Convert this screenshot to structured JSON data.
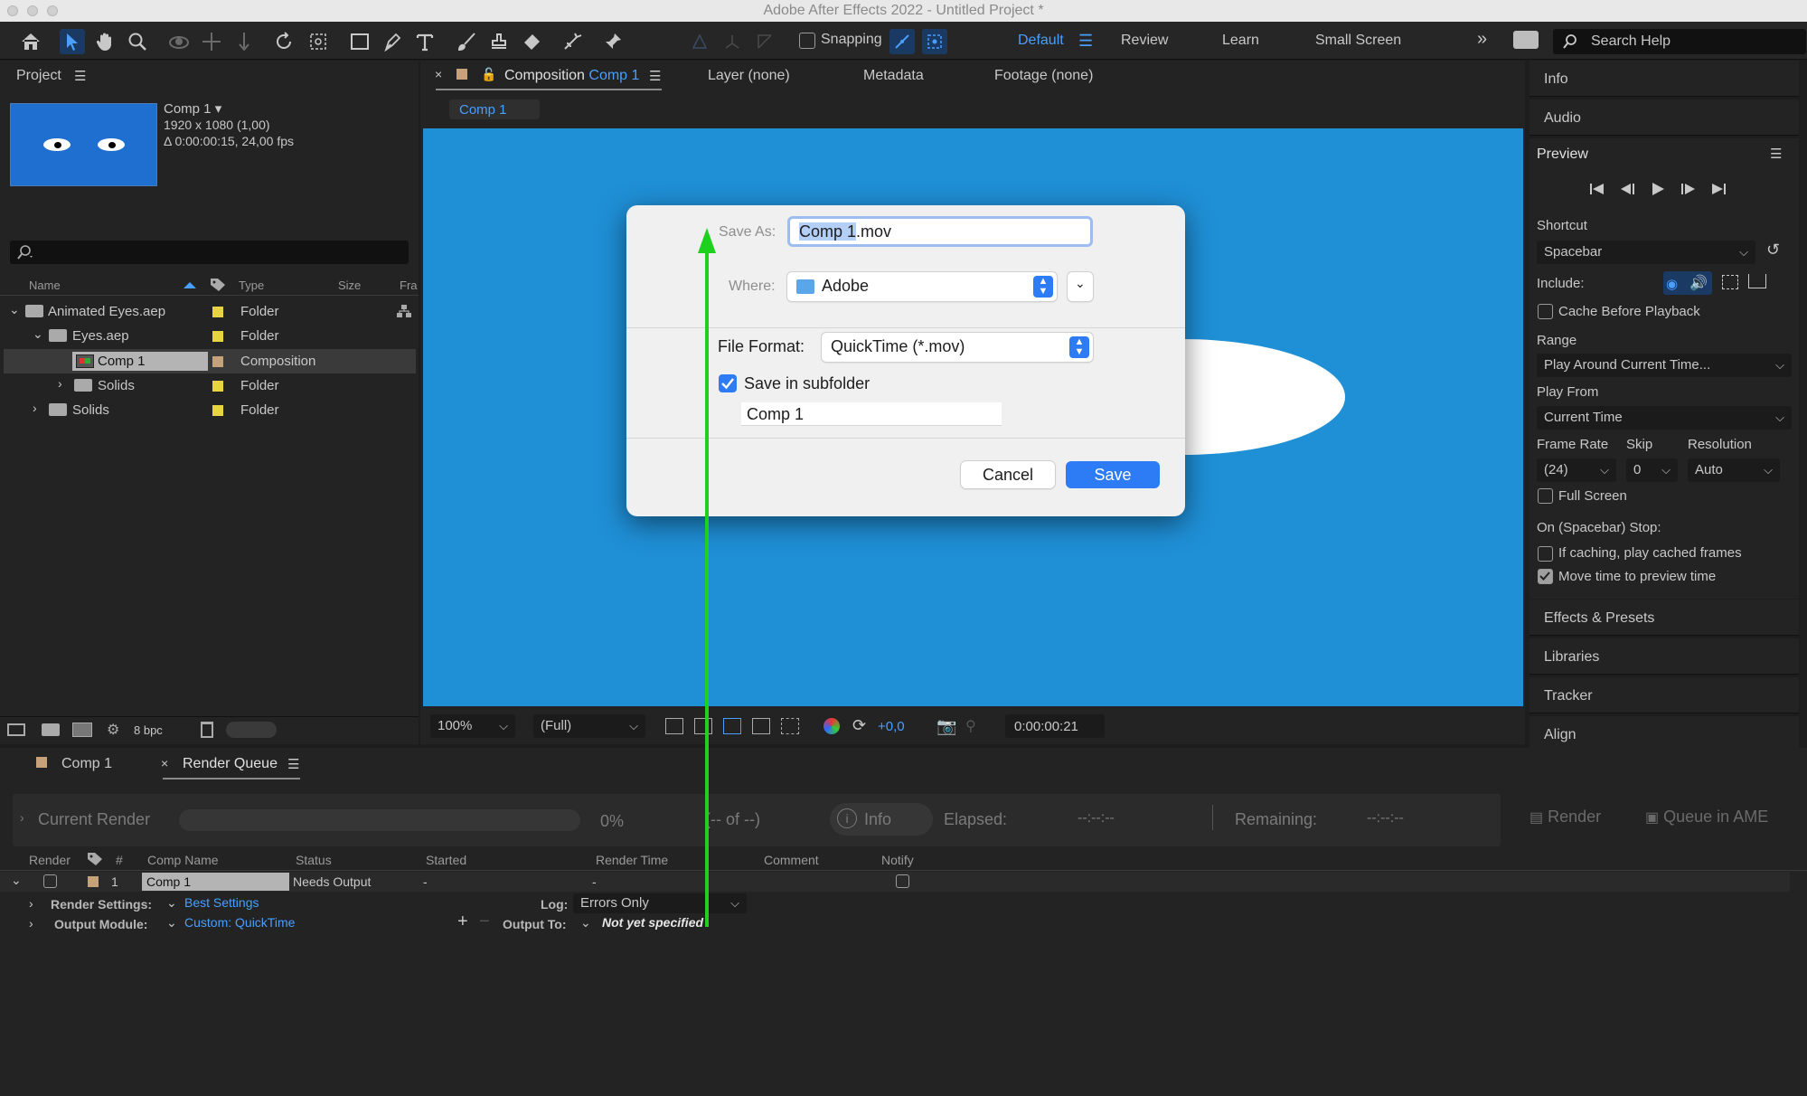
{
  "app": {
    "title": "Adobe After Effects 2022 - Untitled Project *"
  },
  "toolbar": {
    "snapping_label": "Snapping",
    "workspaces": [
      "Default",
      "Review",
      "Learn",
      "Small Screen"
    ],
    "search_placeholder": "Search Help"
  },
  "project": {
    "tab_label": "Project",
    "comp_name": "Comp 1",
    "comp_size": "1920 x 1080 (1,00)",
    "comp_duration": "Δ 0:00:00:15, 24,00 fps",
    "columns": [
      "Name",
      "Type",
      "Size",
      "Fra"
    ],
    "items": [
      {
        "name": "Animated Eyes.aep",
        "type": "Folder"
      },
      {
        "name": "Eyes.aep",
        "type": "Folder"
      },
      {
        "name": "Comp 1",
        "type": "Composition"
      },
      {
        "name": "Solids",
        "type": "Folder"
      },
      {
        "name": "Solids",
        "type": "Folder"
      }
    ],
    "bpc": "8 bpc"
  },
  "viewer": {
    "tabs": {
      "composition_prefix": "Composition",
      "composition_name": "Comp 1",
      "layer": "Layer (none)",
      "metadata": "Metadata",
      "footage": "Footage (none)"
    },
    "breadcrumb": "Comp 1",
    "zoom": "100%",
    "resolution": "(Full)",
    "exposure": "+0,0",
    "timecode": "0:00:00:21",
    "bg_color": "#1f8fd6"
  },
  "dialog": {
    "save_as_label": "Save As:",
    "save_as_selected": "Comp 1",
    "save_as_rest": ".mov",
    "where_label": "Where:",
    "where_value": "Adobe",
    "file_format_label": "File Format:",
    "file_format_value": "QuickTime (*.mov)",
    "subfolder_label": "Save in subfolder",
    "subfolder_checked": true,
    "subfolder_name": "Comp 1",
    "cancel_label": "Cancel",
    "save_label": "Save"
  },
  "right_panel": {
    "info": "Info",
    "audio": "Audio",
    "preview": "Preview",
    "shortcut_label": "Shortcut",
    "shortcut_value": "Spacebar",
    "include_label": "Include:",
    "cache_before_playback": "Cache Before Playback",
    "range_label": "Range",
    "range_value": "Play Around Current Time...",
    "play_from_label": "Play From",
    "play_from_value": "Current Time",
    "frame_rate_label": "Frame Rate",
    "skip_label": "Skip",
    "resolution_label": "Resolution",
    "frame_rate_value": "(24)",
    "skip_value": "0",
    "resolution_value": "Auto",
    "full_screen": "Full Screen",
    "on_stop_label": "On (Spacebar) Stop:",
    "if_caching": "If caching, play cached frames",
    "move_time": "Move time to preview time",
    "move_time_checked": true,
    "effects_presets": "Effects & Presets",
    "libraries": "Libraries",
    "tracker": "Tracker",
    "align": "Align"
  },
  "render_queue": {
    "tabs": [
      "Comp 1",
      "Render Queue"
    ],
    "current_render": "Current Render",
    "progress_pct": "0%",
    "of_text": "(-- of --)",
    "info_btn": "Info",
    "elapsed_label": "Elapsed:",
    "elapsed_value": "--:--:--",
    "remaining_label": "Remaining:",
    "remaining_value": "--:--:--",
    "render_btn": "Render",
    "queue_ame_btn": "Queue in AME",
    "columns": [
      "Render",
      "#",
      "Comp Name",
      "Status",
      "Started",
      "Render Time",
      "Comment",
      "Notify"
    ],
    "item": {
      "number": "1",
      "comp_name": "Comp 1",
      "status": "Needs Output",
      "started": "-",
      "render_time": "-"
    },
    "render_settings_label": "Render Settings:",
    "render_settings_value": "Best Settings",
    "log_label": "Log:",
    "log_value": "Errors Only",
    "output_module_label": "Output Module:",
    "output_module_value": "Custom: QuickTime",
    "output_to_label": "Output To:",
    "output_to_value": "Not yet specified"
  }
}
